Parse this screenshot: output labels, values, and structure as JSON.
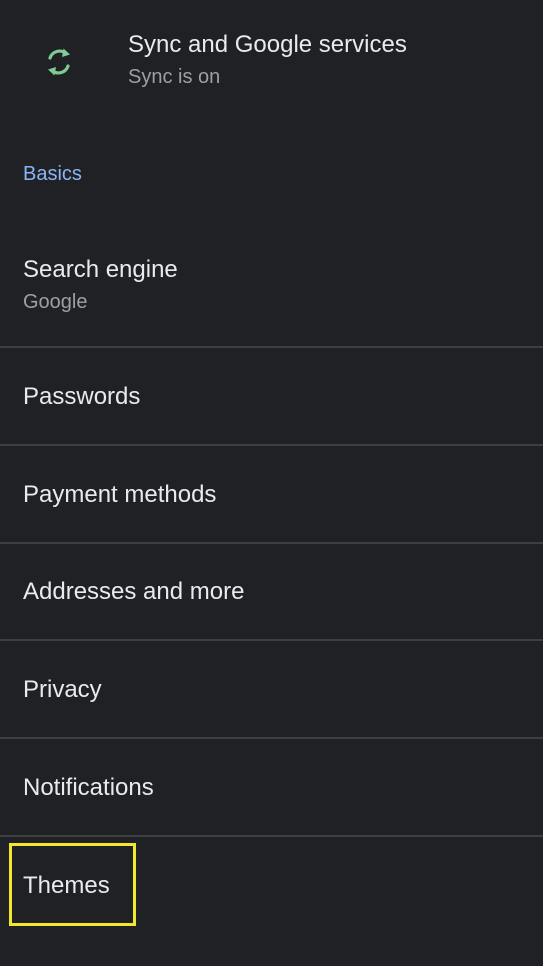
{
  "sync": {
    "title": "Sync and Google services",
    "subtitle": "Sync is on",
    "icon": "sync-icon",
    "icon_color": "#81c995"
  },
  "section": {
    "basics": "Basics"
  },
  "items": [
    {
      "label": "Search engine",
      "sublabel": "Google"
    },
    {
      "label": "Passwords"
    },
    {
      "label": "Payment methods"
    },
    {
      "label": "Addresses and more"
    },
    {
      "label": "Privacy"
    },
    {
      "label": "Notifications"
    },
    {
      "label": "Themes"
    }
  ],
  "colors": {
    "background": "#202124",
    "accent": "#8ab4f8",
    "highlight": "#f2e72a"
  }
}
